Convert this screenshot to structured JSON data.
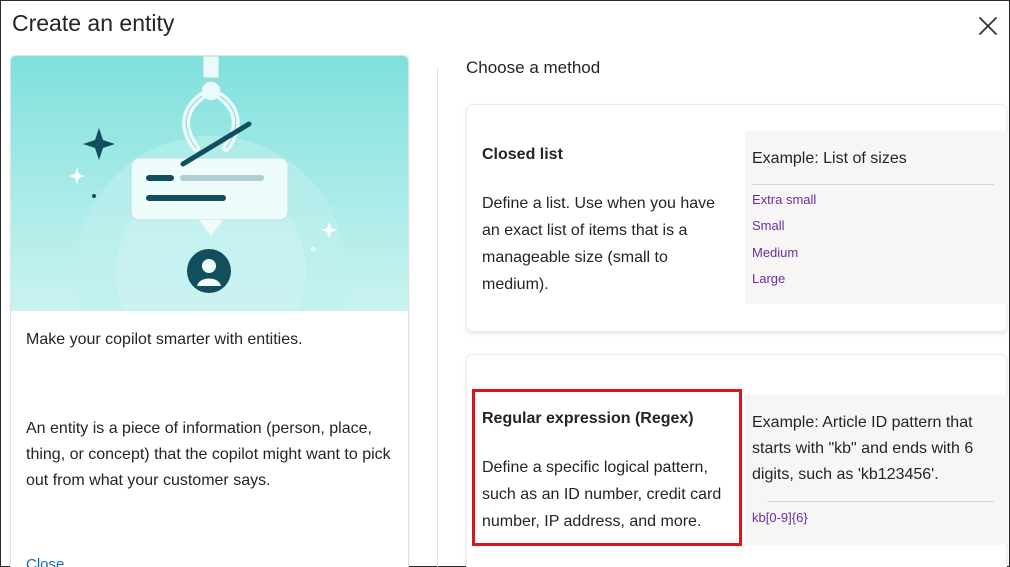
{
  "dialog": {
    "title": "Create an entity",
    "close_icon": "close-icon"
  },
  "left_panel": {
    "illustration": "entity-illustration",
    "intro": "Make your copilot smarter with entities.",
    "description": "An entity is a piece of information (person, place, thing, or concept) that the copilot might want to pick out from what your customer says.",
    "close_link": "Close"
  },
  "methods": {
    "heading": "Choose a method",
    "closed_list": {
      "title": "Closed list",
      "description": "Define a list. Use when you have an exact list of items that is a manageable size (small to medium).",
      "example_title": "Example: List of sizes",
      "example_items": [
        "Extra small",
        "Small",
        "Medium",
        "Large"
      ]
    },
    "regex": {
      "title": "Regular expression (Regex)",
      "description": "Define a specific logical pattern, such as an ID number, credit card number, IP address, and more.",
      "example_title": "Example: Article ID pattern that starts with \"kb\" and ends with 6 digits, such as 'kb123456'.",
      "example_pattern": "kb[0-9]{6}"
    }
  },
  "colors": {
    "accent_link": "#0f6cbd",
    "example_text": "#6b2fa0",
    "highlight": "#d9161f",
    "hero_bg": "#7fe0dc"
  }
}
